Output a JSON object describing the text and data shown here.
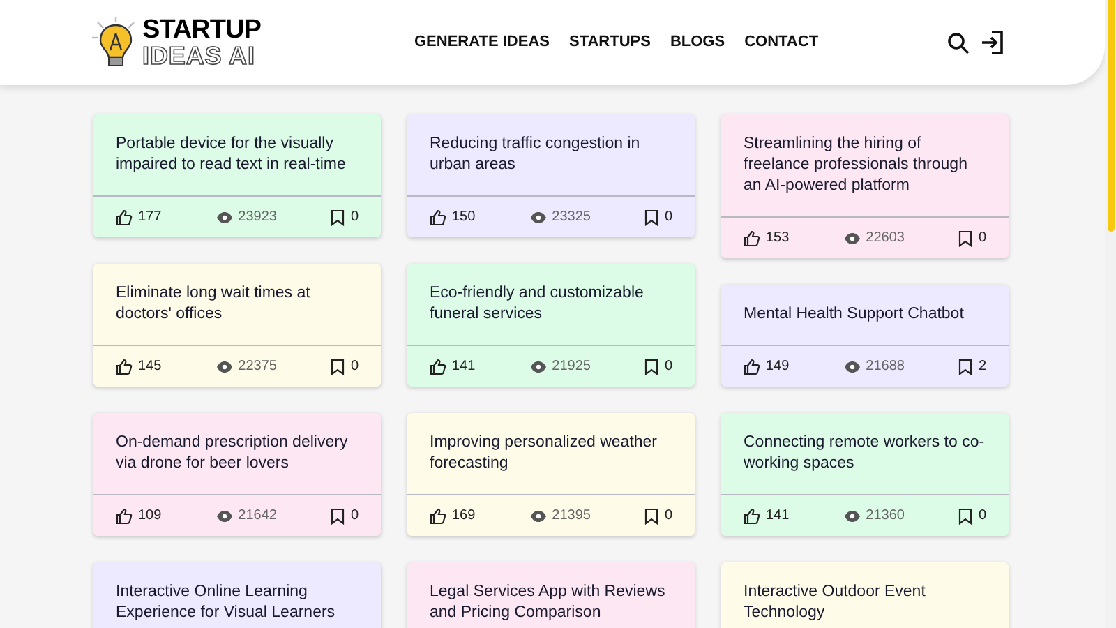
{
  "logo": {
    "line_1": "STARTUP",
    "line_2": "IDEAS AI"
  },
  "nav": [
    "GENERATE IDEAS",
    "STARTUPS",
    "BLOGS",
    "CONTACT"
  ],
  "columns": [
    {
      "cards": [
        {
          "title": "Portable device for the visually impaired to read text in real-time",
          "likes": "177",
          "views": "23923",
          "saves": "0",
          "color": "#dcfce7"
        },
        {
          "title": "Eliminate long wait times at doctors' offices",
          "likes": "145",
          "views": "22375",
          "saves": "0",
          "color": "#fefce8"
        },
        {
          "title": "On-demand prescription delivery via drone for beer lovers",
          "likes": "109",
          "views": "21642",
          "saves": "0",
          "color": "#fce7f3"
        },
        {
          "title": "Interactive Online Learning Experience for Visual Learners",
          "color": "#ede9fe"
        }
      ]
    },
    {
      "cards": [
        {
          "title": "Reducing traffic congestion in urban areas",
          "likes": "150",
          "views": "23325",
          "saves": "0",
          "color": "#ede9fe"
        },
        {
          "title": "Eco-friendly and customizable funeral services",
          "likes": "141",
          "views": "21925",
          "saves": "0",
          "color": "#dcfce7"
        },
        {
          "title": "Improving personalized weather forecasting",
          "likes": "169",
          "views": "21395",
          "saves": "0",
          "color": "#fefce8"
        },
        {
          "title": "Legal Services App with Reviews and Pricing Comparison",
          "color": "#fce7f3"
        }
      ]
    },
    {
      "cards": [
        {
          "title": "Streamlining the hiring of freelance professionals through an AI-powered platform",
          "likes": "153",
          "views": "22603",
          "saves": "0",
          "color": "#fce7f3"
        },
        {
          "title": "Mental Health Support Chatbot",
          "likes": "149",
          "views": "21688",
          "saves": "2",
          "color": "#ede9fe"
        },
        {
          "title": "Connecting remote workers to co-working spaces",
          "likes": "141",
          "views": "21360",
          "saves": "0",
          "color": "#dcfce7"
        },
        {
          "title": "Interactive Outdoor Event Technology",
          "color": "#fefce8"
        }
      ]
    }
  ]
}
